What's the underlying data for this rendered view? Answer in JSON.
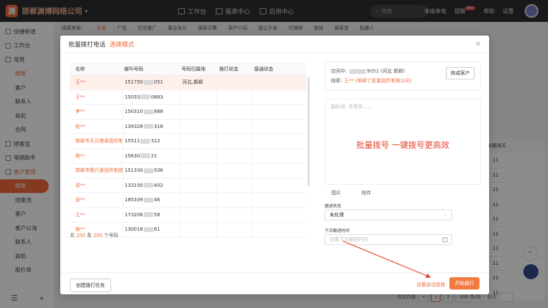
{
  "app": {
    "name": "邯郸渊博网络公司",
    "logo_letter": "渊"
  },
  "topnav": {
    "items": [
      {
        "label": "工作台"
      },
      {
        "label": "报表中心"
      },
      {
        "label": "应用中心"
      }
    ],
    "search_placeholder": "搜索",
    "missed_calls": "未接来电",
    "remind": "提醒",
    "remind_badge": "99+",
    "help": "帮助",
    "settings": "设置"
  },
  "sidebar": {
    "items": [
      {
        "label": "快捷新增"
      },
      {
        "label": "工作台"
      },
      {
        "label": "常用"
      },
      {
        "label": "线索"
      },
      {
        "label": "客户"
      },
      {
        "label": "联系人"
      },
      {
        "label": "商机"
      },
      {
        "label": "合同"
      },
      {
        "label": "搜客宝"
      },
      {
        "label": "电销助手"
      },
      {
        "label": "客户管理"
      },
      {
        "label": "线索"
      },
      {
        "label": "线索池"
      },
      {
        "label": "客户"
      },
      {
        "label": "客户公海"
      },
      {
        "label": "联系人"
      },
      {
        "label": "商机"
      },
      {
        "label": "报价单"
      }
    ]
  },
  "background": {
    "tabs": [
      "线索来源：",
      "全部",
      "广告",
      "社交推广",
      "展会名片",
      "搜索引擎",
      "客户介绍",
      "独立开发",
      "代理商",
      "其他",
      "搜客宝",
      "机器人"
    ],
    "col_header": "未跟进天",
    "rows": [
      "11",
      "11",
      "11",
      "11",
      "11",
      "11",
      "11",
      "11",
      "11",
      "11"
    ],
    "pager": {
      "total": "共325条",
      "prev": "<",
      "current": "1",
      "next": "2",
      "size": "200 条/页",
      "goto": "前往"
    }
  },
  "modal": {
    "title": "批量拨打电话",
    "mode": "连拨模式",
    "close": "×",
    "table": {
      "headers": [
        "名称",
        "被叫号码",
        "号码归属地",
        "拨打状态",
        "接通状态"
      ],
      "rows": [
        {
          "name": "王**",
          "phone_pre": "151750",
          "phone_suf": "051",
          "location": "河北,邯郸"
        },
        {
          "name": "王**",
          "phone_pre": "15033",
          "phone_suf": "0883",
          "location": ""
        },
        {
          "name": "李**",
          "phone_pre": "150310",
          "phone_suf": "888",
          "location": ""
        },
        {
          "name": "赵**",
          "phone_pre": "139328",
          "phone_suf": "318",
          "location": ""
        },
        {
          "name": "邯郸市天贝曼紧固件制",
          "phone_pre": "15511",
          "phone_suf": "312",
          "location": ""
        },
        {
          "name": "杨**",
          "phone_pre": "15630",
          "phone_suf": "21",
          "location": ""
        },
        {
          "name": "邯郸市颢凡紧固件制造",
          "phone_pre": "151330",
          "phone_suf": "936",
          "location": ""
        },
        {
          "name": "梁**",
          "phone_pre": "133150",
          "phone_suf": "402",
          "location": ""
        },
        {
          "name": "张**",
          "phone_pre": "185339",
          "phone_suf": "46",
          "location": ""
        },
        {
          "name": "王**",
          "phone_pre": "173206",
          "phone_suf": "58",
          "location": ""
        },
        {
          "name": "侯**",
          "phone_pre": "130018",
          "phone_suf": "61",
          "location": ""
        }
      ]
    },
    "total": {
      "pre": "共",
      "n1": "200",
      "mid": "条",
      "n2": "200",
      "post": "个号码"
    },
    "info": {
      "calling_label": "空闲中:",
      "calling_value": "9051 (河北 邯郸)",
      "lead_label": "线索:",
      "lead_name": "王** (邯郸丁凯斐固件有限公司)",
      "convert_btn": "转成客户"
    },
    "note_placeholder": "副标语, 多签单......",
    "note_promo": "批量拨号 一键拨号更高效",
    "attach": {
      "image": "图片",
      "file": "附件"
    },
    "followup_status_label": "跟进状态",
    "followup_status_value": "未处理",
    "next_time_label": "下次跟进时间",
    "next_time_placeholder": "设置下次跟进时间",
    "create_task_btn": "创建拨打任务",
    "auto_link": "设置自动连拨",
    "start_btn": "开始拨打"
  },
  "colors": {
    "accent": "#f26b3a",
    "topbar": "#2f2f33",
    "promo_red": "#e5452e"
  }
}
